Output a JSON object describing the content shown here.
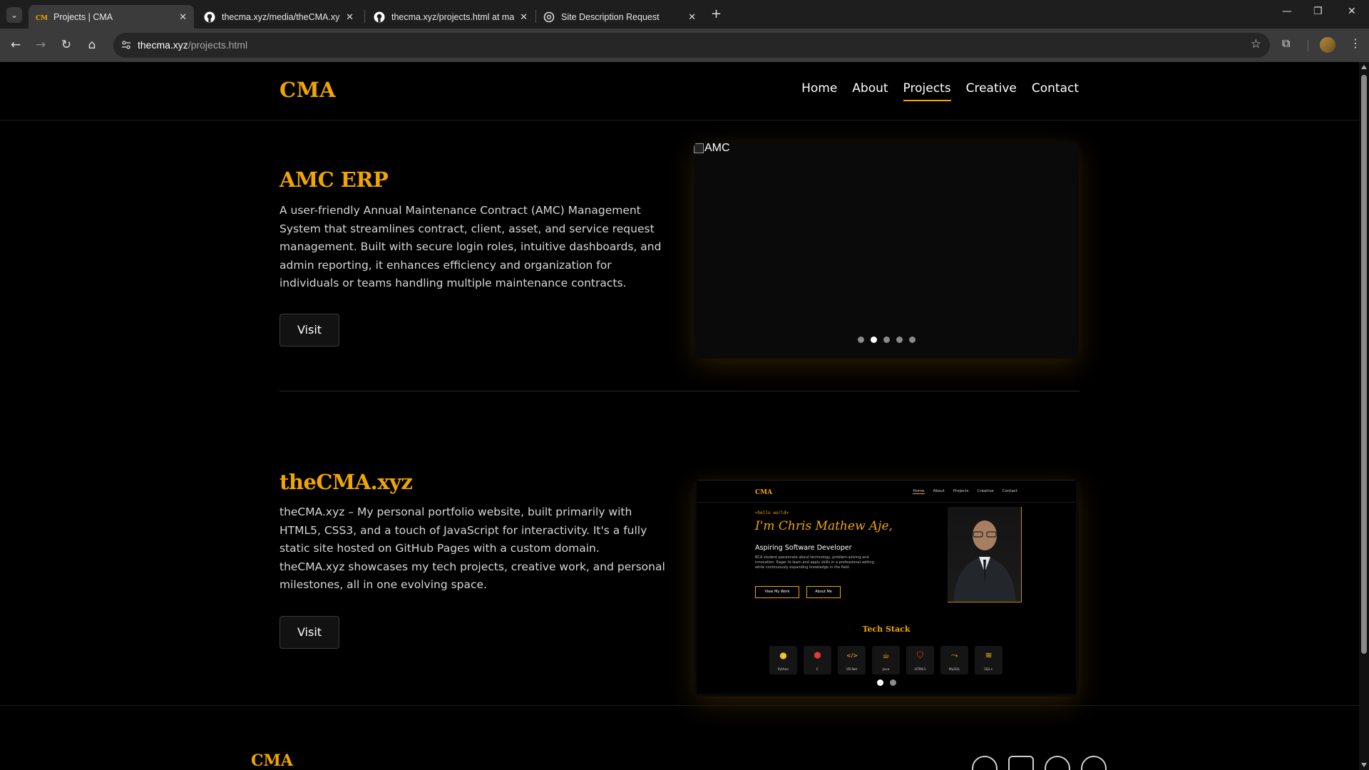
{
  "browser": {
    "tabs": [
      {
        "title": "Projects | CMA",
        "active": true,
        "favicon": "cma-logo-icon"
      },
      {
        "title": "thecma.xyz/media/theCMA.xyz",
        "active": false,
        "favicon": "github-icon"
      },
      {
        "title": "thecma.xyz/projects.html at ma",
        "active": false,
        "favicon": "github-icon"
      },
      {
        "title": "Site Description Request",
        "active": false,
        "favicon": "chatgpt-icon"
      }
    ],
    "url_host": "thecma.xyz",
    "url_path": "/projects.html"
  },
  "site": {
    "logo": "CMA",
    "nav": [
      "Home",
      "About",
      "Projects",
      "Creative",
      "Contact"
    ],
    "active_nav": "Projects",
    "accent": "#f0a500"
  },
  "projects": [
    {
      "title": "AMC ERP",
      "description": "A user-friendly Annual Maintenance Contract (AMC) Management System that streamlines contract, client, asset, and service request management. Built with secure login roles, intuitive dashboards, and admin reporting, it enhances efficiency and organization for individuals or teams handling multiple maintenance contracts.",
      "button": "Visit",
      "image_alt": "AMC",
      "slides": 5,
      "active_slide": 2
    },
    {
      "title": "theCMA.xyz",
      "description": "theCMA.xyz – My personal portfolio website, built primarily with HTML5, CSS3, and a touch of JavaScript for interactivity. It's a fully static site hosted on GitHub Pages with a custom domain. theCMA.xyz showcases my tech projects, creative work, and personal milestones, all in one evolving space.",
      "button": "Visit",
      "slides": 2,
      "active_slide": 1,
      "preview": {
        "logo": "CMA",
        "nav": [
          "Home",
          "About",
          "Projects",
          "Creative",
          "Contact"
        ],
        "hello": "<hello world>",
        "name": "I'm Chris Mathew Aje,",
        "role": "Aspiring Software Developer",
        "bio": "BCA student passionate about technology, problem-solving and innovation. Eager to learn and apply skills in a professional setting while continuously expanding knowledge in the field.",
        "btn_work": "View My Work",
        "btn_about": "About Me",
        "tech_title": "Tech Stack",
        "tech": [
          {
            "label": "Python",
            "icon": "python-icon",
            "color": "#f6c12d"
          },
          {
            "label": "C",
            "icon": "c-icon",
            "color": "#e53935"
          },
          {
            "label": "VB.Net",
            "icon": "code-icon",
            "color": "#f6c12d"
          },
          {
            "label": "Java",
            "icon": "java-icon",
            "color": "#f0a500"
          },
          {
            "label": "HTML5",
            "icon": "html5-icon",
            "color": "#e44d26"
          },
          {
            "label": "MySQL",
            "icon": "mysql-icon",
            "color": "#f0a500"
          },
          {
            "label": "SQL+",
            "icon": "database-icon",
            "color": "#f6c12d"
          }
        ]
      }
    }
  ],
  "footer": {
    "logo": "CMA",
    "social": [
      "github-icon",
      "linkedin-icon",
      "instagram-icon",
      "mail-icon"
    ]
  }
}
